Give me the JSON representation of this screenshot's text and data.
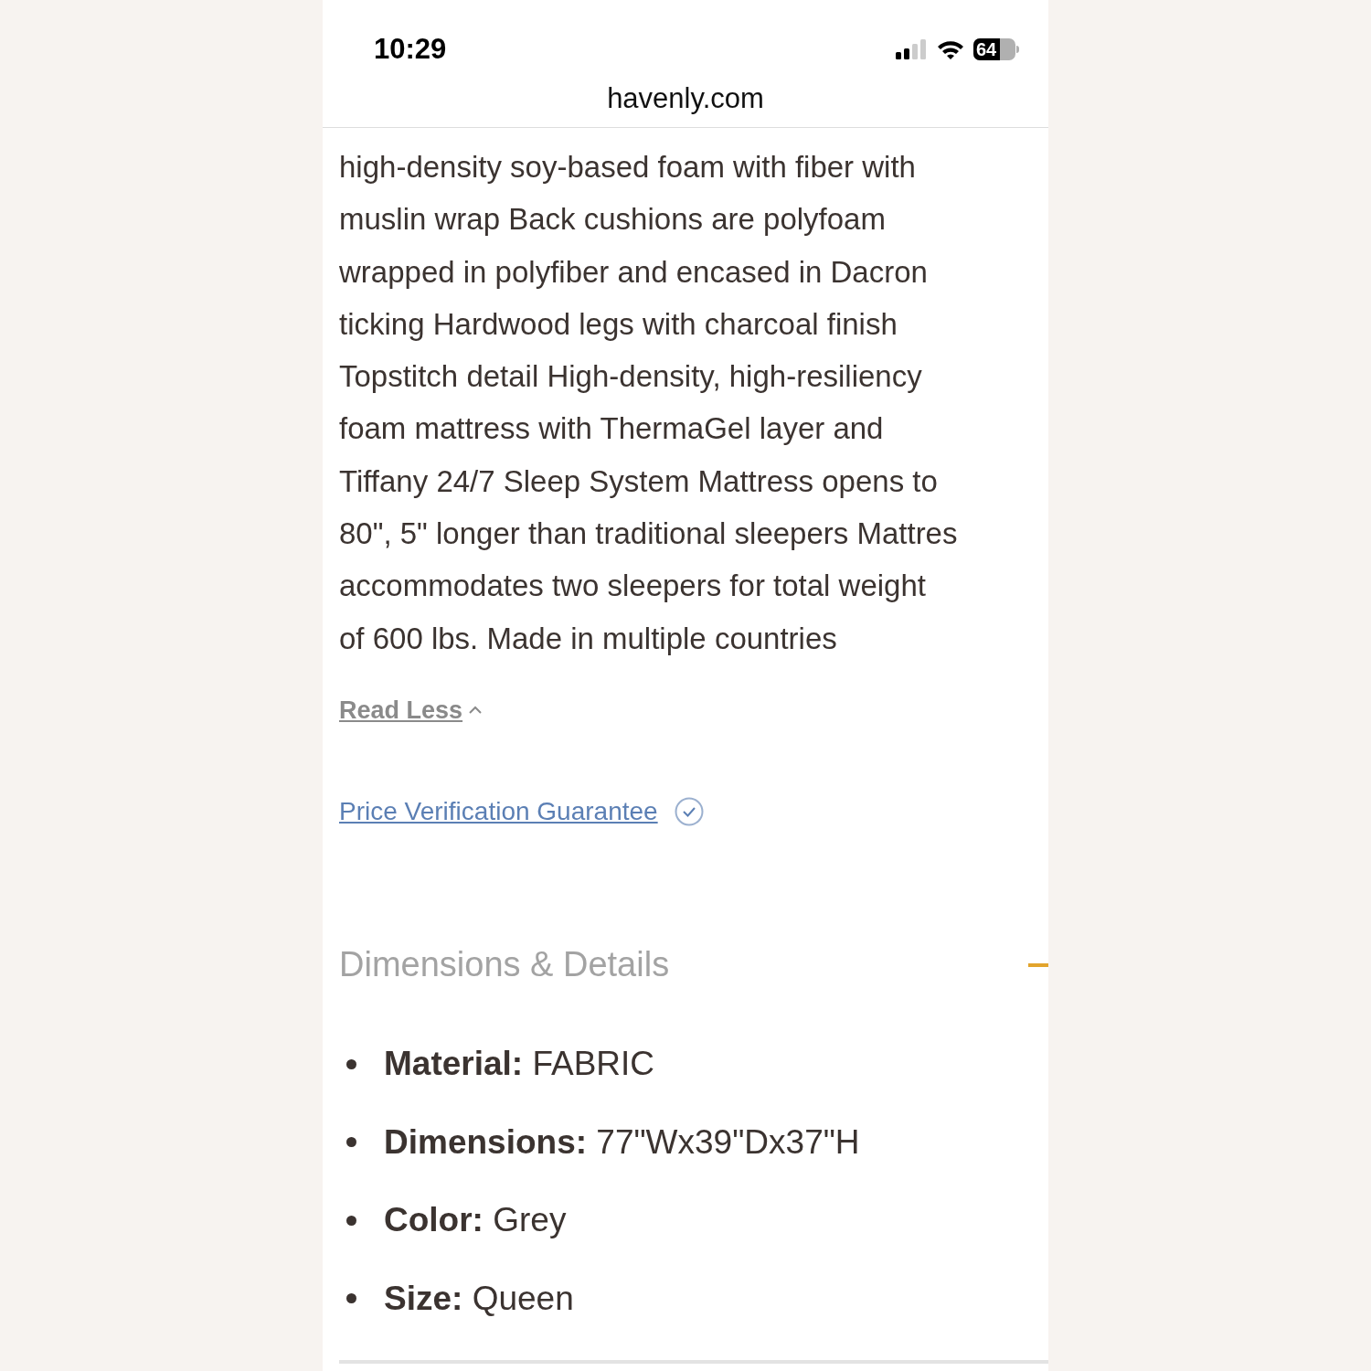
{
  "status_bar": {
    "time": "10:29",
    "battery": "64"
  },
  "address_bar": {
    "url": "havenly.com"
  },
  "description": {
    "lines": [
      "high-density soy-based foam with fiber with",
      "muslin wrap Back cushions are polyfoam",
      "wrapped in polyfiber and encased in Dacron",
      "ticking Hardwood legs with charcoal finish",
      "Topstitch detail High-density, high-resiliency",
      "foam mattress with ThermaGel layer and",
      "Tiffany 24/7 Sleep System Mattress opens to",
      "80\", 5\" longer than traditional sleepers Mattres",
      "accommodates two sleepers for total weight",
      "of 600 lbs. Made in multiple countries"
    ]
  },
  "read_less": {
    "label": "Read Less"
  },
  "price_guarantee": {
    "label": "Price Verification Guarantee"
  },
  "accordion": {
    "title": "Dimensions & Details",
    "expanded": true,
    "details": [
      {
        "label": "Material:",
        "value": "FABRIC"
      },
      {
        "label": "Dimensions:",
        "value": "77\"Wx39\"Dx37\"H"
      },
      {
        "label": "Color:",
        "value": "Grey"
      },
      {
        "label": "Size:",
        "value": "Queen"
      }
    ]
  }
}
